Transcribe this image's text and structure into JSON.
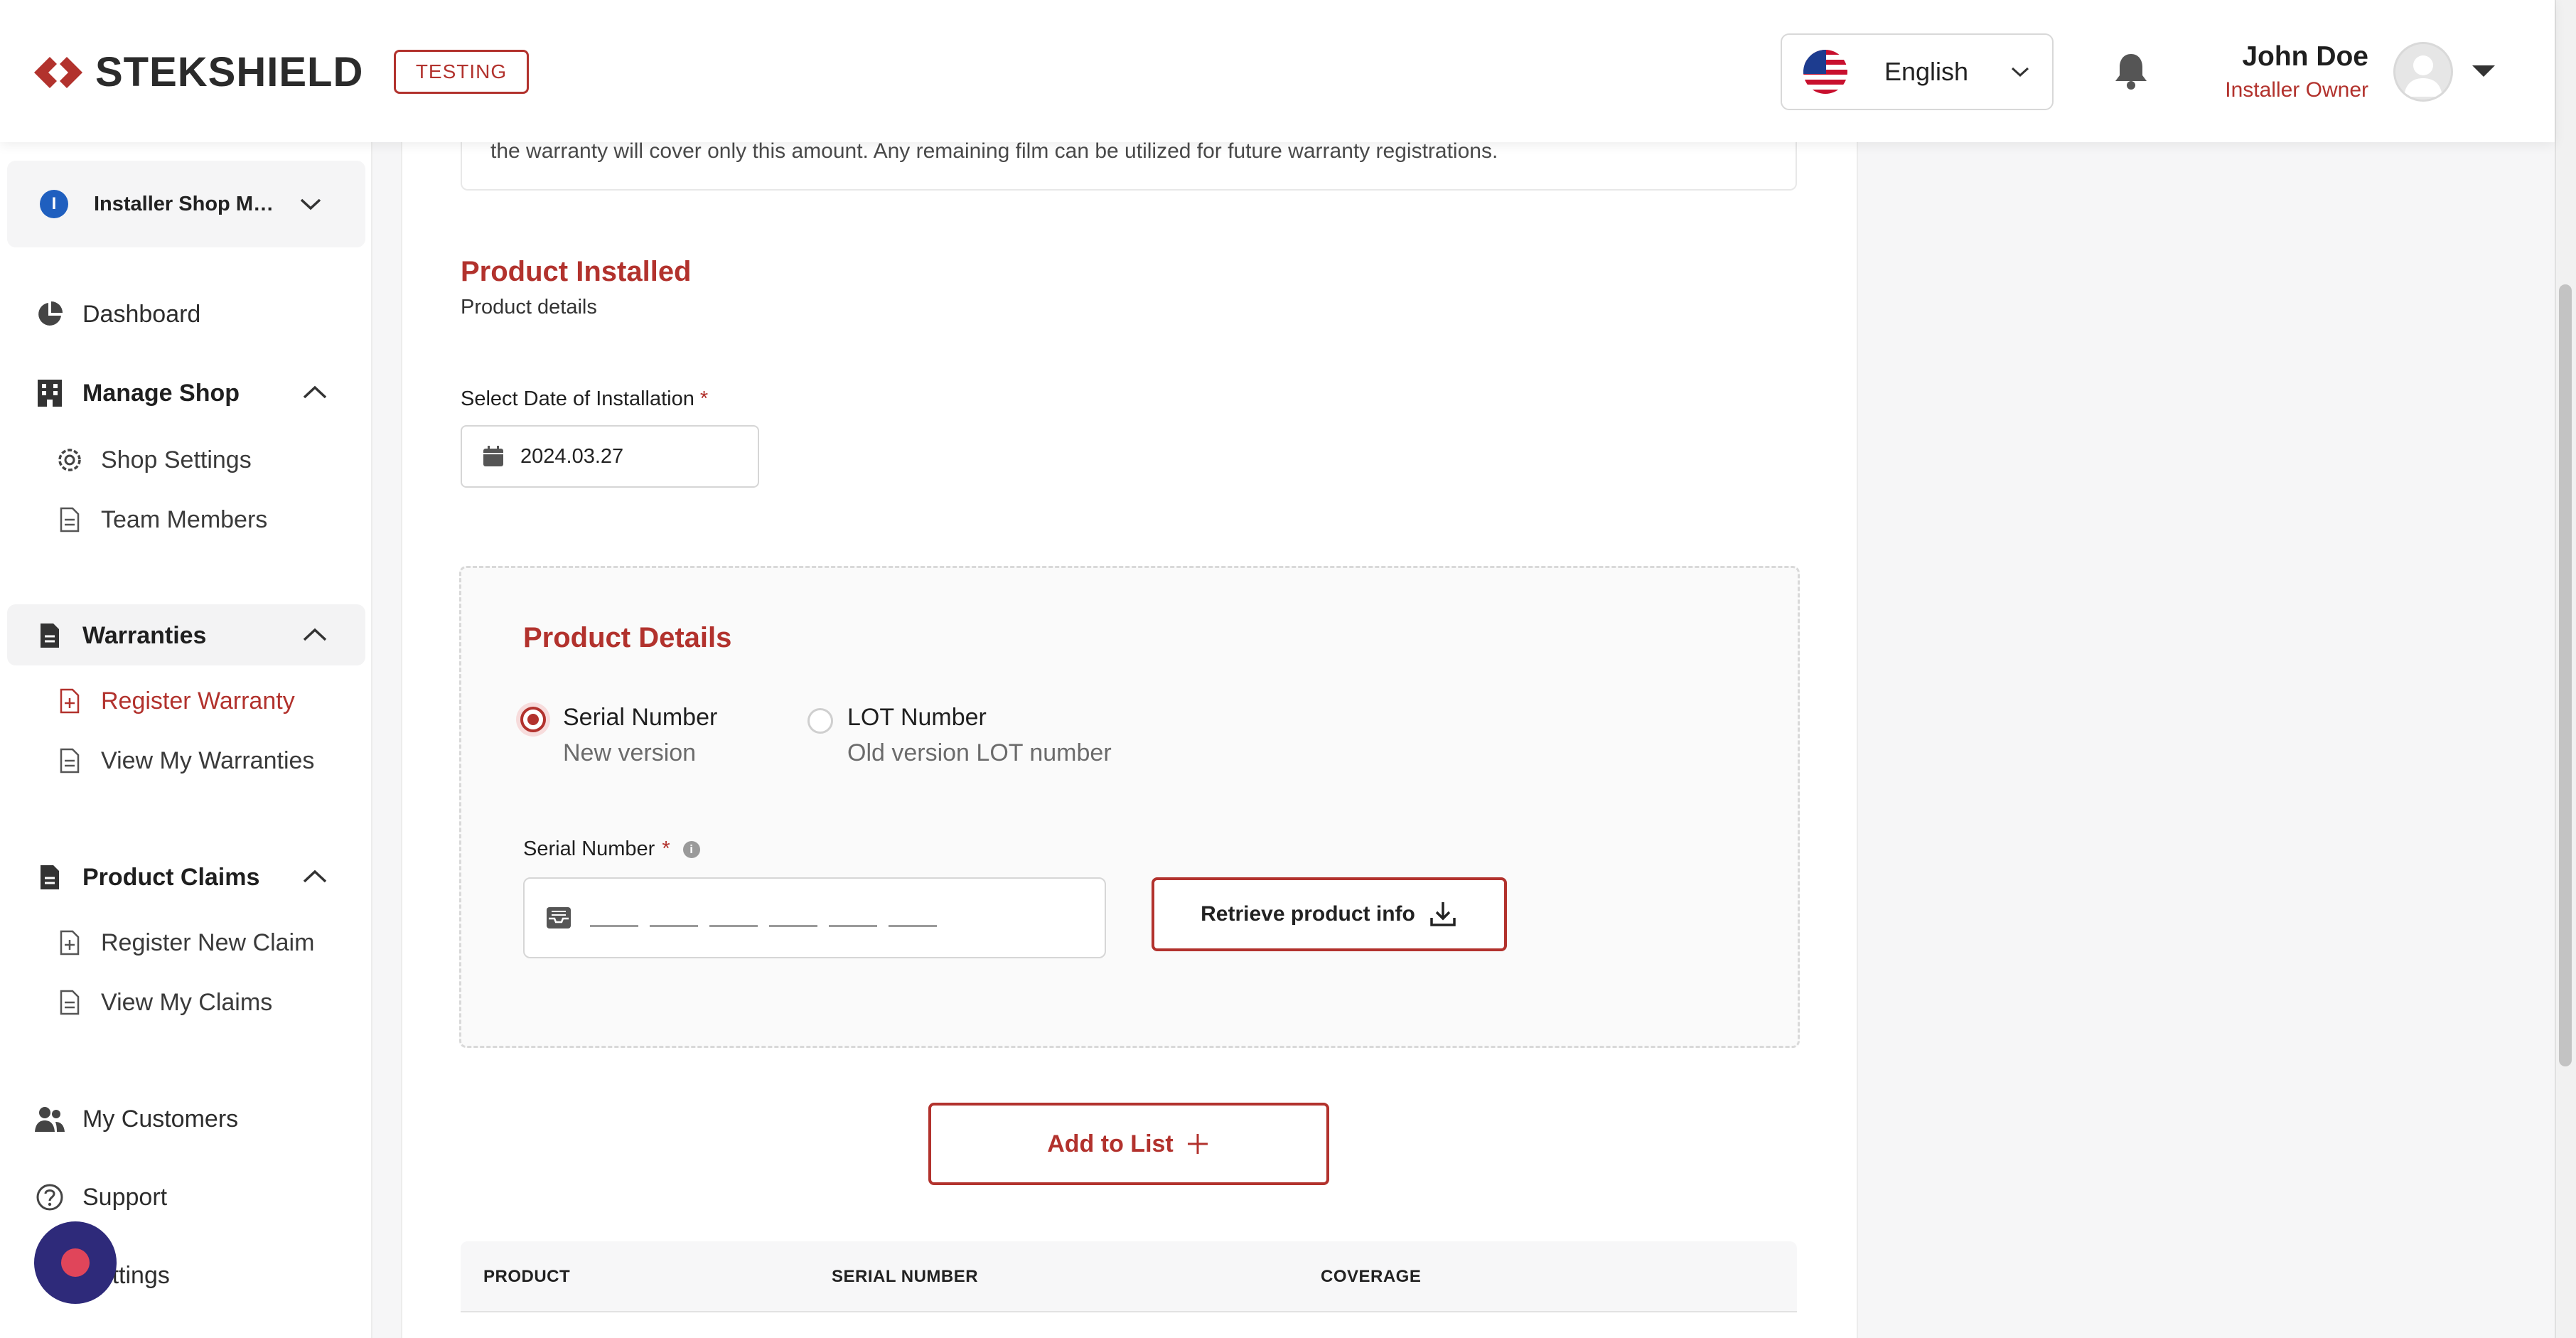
{
  "header": {
    "brand": "STEKSHIELD",
    "env_badge": "TESTING",
    "language": "English",
    "user_name": "John Doe",
    "user_role": "Installer Owner"
  },
  "sidebar": {
    "shop_initial": "I",
    "shop_name": "Installer Shop Main",
    "dashboard": "Dashboard",
    "manage_shop": "Manage Shop",
    "shop_settings": "Shop Settings",
    "team_members": "Team Members",
    "warranties": "Warranties",
    "register_warranty": "Register Warranty",
    "view_my_warranties": "View My Warranties",
    "product_claims": "Product Claims",
    "register_new_claim": "Register New Claim",
    "view_my_claims": "View My Claims",
    "my_customers": "My Customers",
    "support": "Support",
    "settings": "Settings"
  },
  "main": {
    "note_text": "the warranty will cover only this amount. Any remaining film can be utilized for future warranty registrations.",
    "section_title": "Product Installed",
    "section_subtitle": "Product details",
    "date_label": "Select Date of Installation",
    "required_mark": "*",
    "date_value": "2024.03.27",
    "details_title": "Product Details",
    "option_serial_label": "Serial Number",
    "option_serial_sub": "New version",
    "option_lot_label": "LOT Number",
    "option_lot_sub": "Old version LOT number",
    "serial_field_label": "Serial Number",
    "info_glyph": "i",
    "retrieve_button": "Retrieve product info",
    "add_button": "Add to List",
    "table_headers": [
      "PRODUCT",
      "SERIAL NUMBER",
      "COVERAGE"
    ]
  },
  "colors": {
    "accent": "#b2322d",
    "fab": "#2e2a7a"
  }
}
